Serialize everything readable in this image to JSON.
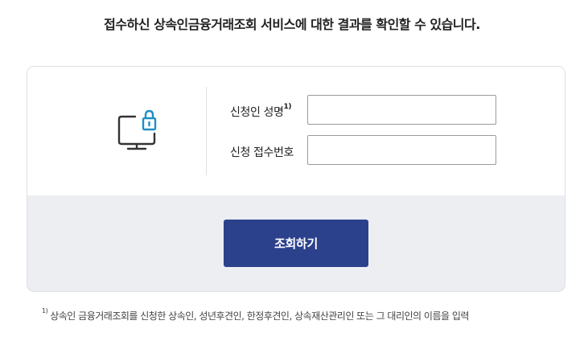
{
  "headline": "접수하신 상속인금융거래조회 서비스에 대한 결과를 확인할 수 있습니다.",
  "form": {
    "name_label": "신청인 성명",
    "name_footnote_mark": "1)",
    "name_value": "",
    "receipt_label": "신청 접수번호",
    "receipt_value": ""
  },
  "submit_label": "조회하기",
  "footnote": {
    "mark": "1)",
    "text": "상속인 금융거래조회를 신청한 상속인, 성년후견인, 한정후견인, 상속재산관리인 또는 그 대리인의 이름을 입력"
  },
  "icon": "monitor-lock-icon",
  "colors": {
    "button": "#2c418c",
    "lock": "#1e8fc6",
    "monitor": "#333333",
    "card_bottom": "#eceef2"
  }
}
